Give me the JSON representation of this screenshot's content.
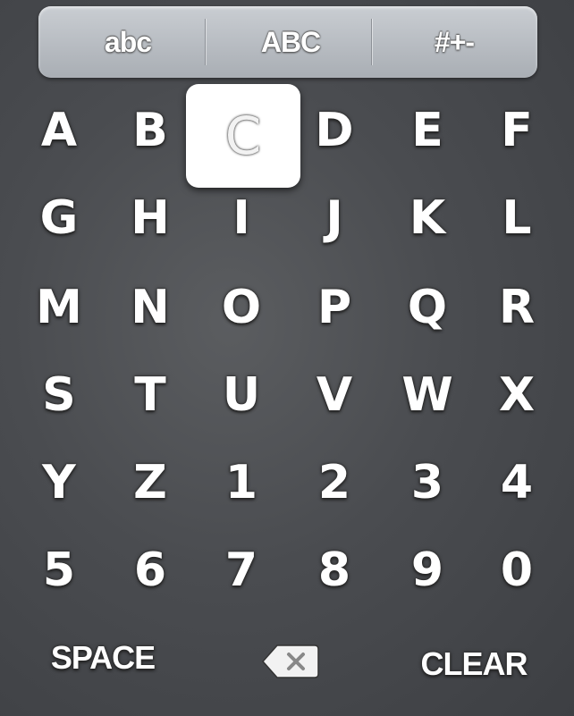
{
  "mode_bar": {
    "lowercase_label": "abc",
    "uppercase_label": "ABC",
    "symbols_label": "#+-"
  },
  "keys": [
    "A",
    "B",
    "C",
    "D",
    "E",
    "F",
    "G",
    "H",
    "I",
    "J",
    "K",
    "L",
    "M",
    "N",
    "O",
    "P",
    "Q",
    "R",
    "S",
    "T",
    "U",
    "V",
    "W",
    "X",
    "Y",
    "Z",
    "1",
    "2",
    "3",
    "4",
    "5",
    "6",
    "7",
    "8",
    "9",
    "0"
  ],
  "selected_key": "C",
  "bottom": {
    "space_label": "SPACE",
    "clear_label": "CLEAR",
    "backspace_icon": "backspace-icon"
  }
}
